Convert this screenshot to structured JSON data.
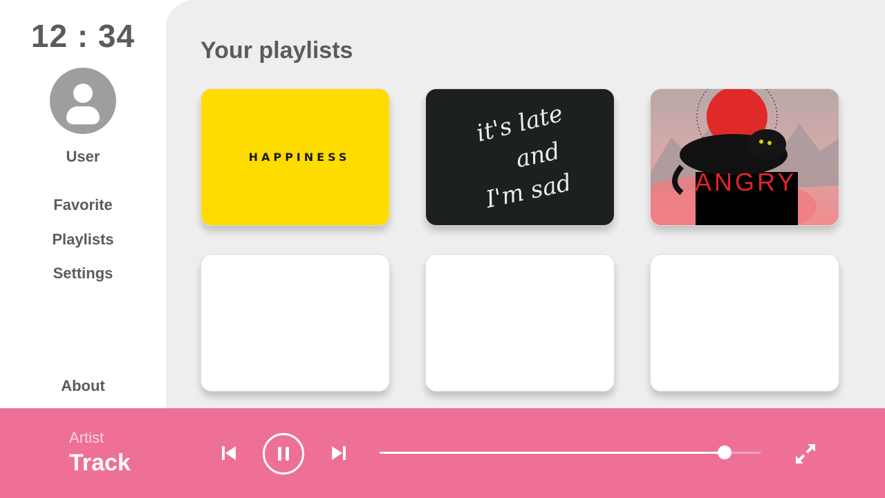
{
  "sidebar": {
    "clock": "12 : 34",
    "avatar_icon": "user-avatar-icon",
    "username": "User",
    "nav": [
      "Favorite",
      "Playlists",
      "Settings"
    ],
    "about": "About"
  },
  "main": {
    "title": "Your playlists",
    "cards": [
      {
        "cover_text": "HAPPINESS",
        "cover_color": "#ffdc00"
      },
      {
        "cover_lines": [
          "it's late",
          "and",
          "I'm sad"
        ],
        "cover_color": "#1c211f"
      },
      {
        "cover_text": "ANGRY",
        "cover_color": "#ef8a8c"
      },
      {
        "cover_color": "#ffffff"
      },
      {
        "cover_color": "#ffffff"
      },
      {
        "cover_color": "#ffffff"
      }
    ]
  },
  "player": {
    "artist": "Artist",
    "track": "Track",
    "progress": 0.905,
    "icons": {
      "previous": "skip-previous-icon",
      "pause": "pause-icon",
      "next": "skip-next-icon",
      "expand": "expand-icon"
    }
  },
  "colors": {
    "accent": "#ee7096",
    "panel": "#eeeeee",
    "text": "#5b5b5b",
    "angry_red": "#e4232b"
  }
}
